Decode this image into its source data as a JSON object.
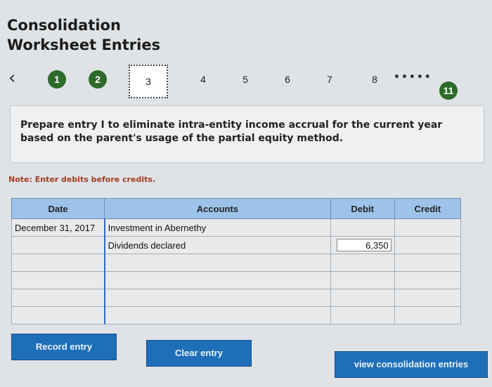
{
  "header": {
    "title_line1": "Consolidation",
    "title_line2": "Worksheet Entries"
  },
  "nav": {
    "back_icon": "chevron-left-icon",
    "items": [
      {
        "label": "1",
        "state": "done"
      },
      {
        "label": "2",
        "state": "done"
      },
      {
        "label": "3",
        "state": "current"
      },
      {
        "label": "4",
        "state": "pending"
      },
      {
        "label": "5",
        "state": "pending"
      },
      {
        "label": "6",
        "state": "pending"
      },
      {
        "label": "7",
        "state": "pending"
      },
      {
        "label": "8",
        "state": "pending"
      },
      {
        "label": "11",
        "state": "done"
      }
    ],
    "dots": "•••••",
    "done_color": "#2e6b2a"
  },
  "prompt": {
    "text": "Prepare entry I to eliminate intra-entity income accrual for the current year based on the parent's usage of the partial equity method."
  },
  "note": "Note: Enter debits before credits.",
  "journal": {
    "headers": {
      "date": "Date",
      "accounts": "Accounts",
      "debit": "Debit",
      "credit": "Credit"
    },
    "rows": [
      {
        "date": "December 31, 2017",
        "account": "Investment in Abernethy",
        "debit": "",
        "credit": ""
      },
      {
        "date": "",
        "account": "Dividends declared",
        "debit": "6,350",
        "credit": ""
      },
      {
        "date": "",
        "account": "",
        "debit": "",
        "credit": ""
      },
      {
        "date": "",
        "account": "",
        "debit": "",
        "credit": ""
      },
      {
        "date": "",
        "account": "",
        "debit": "",
        "credit": ""
      },
      {
        "date": "",
        "account": "",
        "debit": "",
        "credit": ""
      }
    ],
    "header_color": "#9dc3ea"
  },
  "buttons": {
    "record": "Record entry",
    "clear": "Clear entry",
    "view": "view consolidation entries"
  }
}
